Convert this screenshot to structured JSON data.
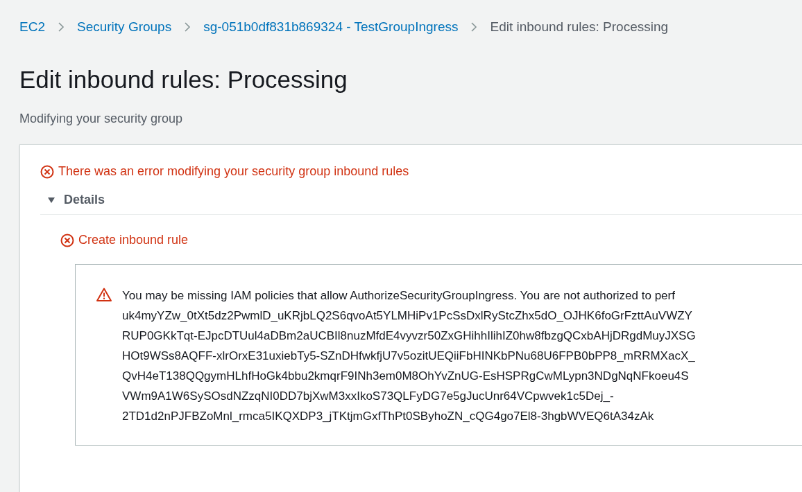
{
  "breadcrumb": [
    {
      "label": "EC2",
      "kind": "link"
    },
    {
      "label": "Security Groups",
      "kind": "link"
    },
    {
      "label": "sg-051b0df831b869324 - TestGroupIngress",
      "kind": "link"
    },
    {
      "label": "Edit inbound rules: Processing",
      "kind": "current"
    }
  ],
  "page": {
    "title": "Edit inbound rules: Processing",
    "subtitle": "Modifying your security group"
  },
  "error": {
    "title": "There was an error modifying your security group inbound rules",
    "details": {
      "label": "Details",
      "expanded": true,
      "items": [
        {
          "title": "Create inbound rule",
          "message_lines": [
            "You may be missing IAM policies that allow AuthorizeSecurityGroupIngress. You are not authorized to perf",
            "uk4myYZw_0tXt5dz2PwmlD_uKRjbLQ2S6qvoAt5YLMHiPv1PcSsDxlRyStcZhx5dO_OJHK6foGrFzttAuVWZY",
            "RUP0GKkTqt-EJpcDTUul4aDBm2aUCBIl8nuzMfdE4vyvzr50ZxGHihhIlihIZ0hw8fbzgQCxbAHjDRgdMuyJXSG",
            "HOt9WSs8AQFF-xlrOrxE31uxiebTy5-SZnDHfwkfjU7v5ozitUEQiiFbHINKbPNu68U6FPB0bPP8_mRRMXacX_",
            "QvH4eT138QQgymHLhfHoGk4bbu2kmqrF9INh3em0M8OhYvZnUG-EsHSPRgCwMLypn3NDgNqNFkoeu4S",
            "VWm9A1W6SySOsdNZzqNI0DD7bjXwM3xxIkoS73QLFyDG7e5gJucUnr64VCpwvek1c5Dej_-",
            "2TD1d2nPJFBZoMnl_rmca5IKQXDP3_jTKtjmGxfThPt0SByhoZN_cQG4go7El8-3hgbWVEQ6tA34zAk"
          ]
        }
      ]
    }
  }
}
